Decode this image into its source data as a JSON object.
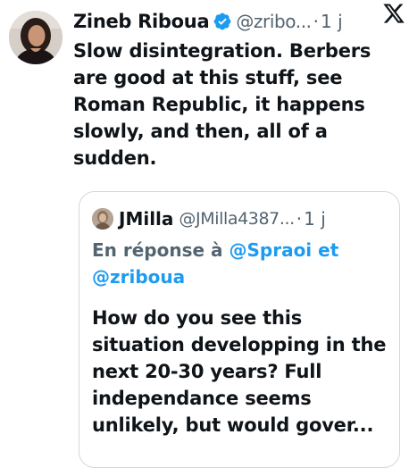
{
  "tweet": {
    "author_name": "Zineb Riboua",
    "author_handle": "@zribo...",
    "separator": "·",
    "time": "1 j",
    "text": "Slow disintegration. Berbers are good at this stuff, see Roman Republic, it happens slowly, and then, all of a sudden.",
    "avatar_icon": "profile-photo-woman",
    "verified_icon": "verified-badge-icon",
    "brand_icon": "x-logo-icon",
    "verified_color": "#1d9bf0"
  },
  "quoted_tweet": {
    "author_name": "JMilla",
    "author_handle": "@JMilla4387...",
    "separator": "·",
    "time": "1 j",
    "reply_prefix": "En réponse à",
    "reply_mention_1": "@Spraoi",
    "reply_conjunction": "et",
    "reply_mention_2": "@zriboua",
    "text": "How do you see this situation developping in the next 20-30 years? Full independance seems unlikely, but would gover...",
    "mention_color": "#1d9bf0"
  }
}
